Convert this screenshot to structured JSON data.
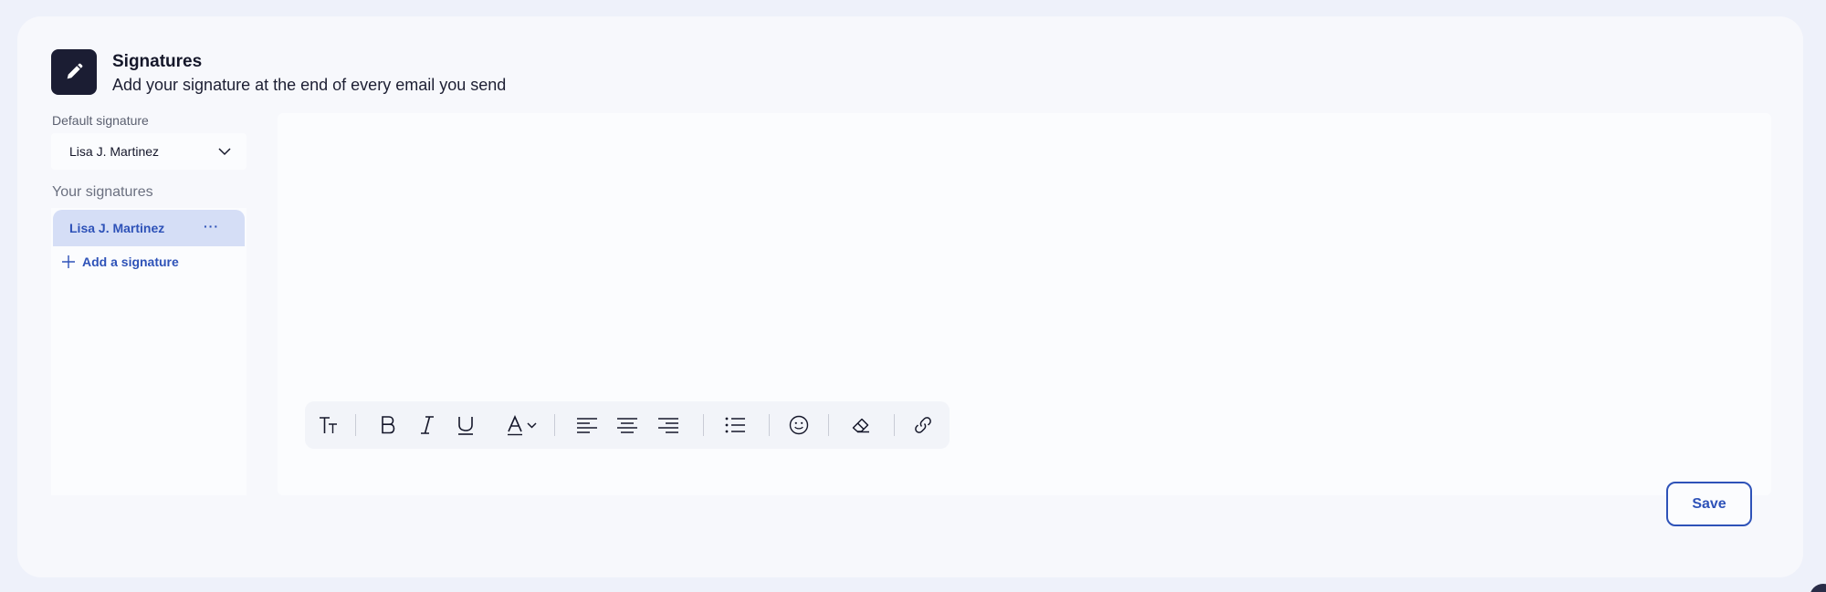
{
  "header": {
    "title": "Signatures",
    "subtitle": "Add your signature at the end of every email you send",
    "icon": "pencil-icon"
  },
  "default_signature": {
    "label": "Default signature",
    "selected": "Lisa J. Martinez"
  },
  "your_signatures": {
    "label": "Your signatures",
    "items": [
      {
        "name": "Lisa J. Martinez",
        "selected": true,
        "menu": "···"
      }
    ],
    "add_label": "Add a signature"
  },
  "toolbar": {
    "buttons": [
      "text-size-icon",
      "bold-icon",
      "italic-icon",
      "underline-icon",
      "text-color-icon",
      "align-left-icon",
      "align-center-icon",
      "align-right-icon",
      "bullet-list-icon",
      "emoji-icon",
      "eraser-icon",
      "link-icon"
    ]
  },
  "actions": {
    "save_label": "Save"
  },
  "colors": {
    "accent": "#2e52b8",
    "selected_bg": "#d5def6",
    "header_icon_bg": "#1b1d33",
    "page_bg": "#eef1fa"
  }
}
